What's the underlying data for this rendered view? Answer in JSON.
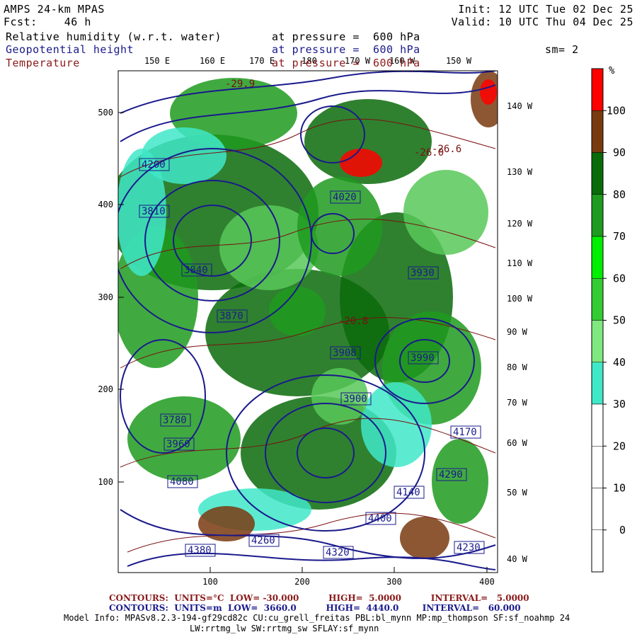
{
  "header": {
    "model": "AMPS 24-km MPAS",
    "fcst_label": "Fcst:",
    "fcst_value": "46 h",
    "init": "Init: 12 UTC Tue 02 Dec 25",
    "valid": "Valid: 10 UTC Thu 04 Dec 25",
    "fields": [
      {
        "name": "Relative humidity (w.r.t. water)",
        "level": "at pressure =  600 hPa",
        "color": "#000000"
      },
      {
        "name": "Geopotential height",
        "level": "at pressure =  600 hPa",
        "color": "#1a1a8c"
      },
      {
        "name": "Temperature",
        "level": "at pressure =  600 hPa",
        "color": "#8b1a1a"
      }
    ],
    "smoothing": "sm= 2"
  },
  "map": {
    "top_labels": [
      "150 E",
      "160 E",
      "170 E",
      "180",
      "170 W",
      "160 W",
      "150 W"
    ],
    "right_labels": [
      "140 W",
      "130 W",
      "120 W",
      "110 W",
      "100 W",
      "90 W",
      "80 W",
      "70 W",
      "60 W",
      "50 W",
      "40 W"
    ],
    "left_ticks": [
      "500",
      "400",
      "300",
      "200",
      "100"
    ],
    "bottom_ticks": [
      "100",
      "200",
      "300",
      "400"
    ],
    "height_labels": [
      "4380",
      "4260",
      "4200",
      "4080",
      "3960",
      "3840",
      "3870",
      "3900",
      "3908",
      "3990",
      "4020",
      "4140",
      "4320",
      "4290",
      "4230",
      "4400",
      "4170",
      "3930",
      "3810",
      "3780"
    ],
    "temp_labels": [
      "-29.9",
      "-20.8",
      "-26.0",
      "-26.6"
    ],
    "colors": {
      "height": "#1a1a8c",
      "temperature": "#7a1010",
      "rh_dark_green": "#0a6b0a",
      "rh_green": "#1f9b1f",
      "rh_light_green": "#58c858",
      "rh_cyan": "#3fe8c8",
      "rh_brown": "#7a3a10",
      "rh_red": "#ff0000"
    }
  },
  "colorbar": {
    "unit": "%",
    "labels": [
      "100",
      "90",
      "80",
      "70",
      "60",
      "50",
      "40",
      "30",
      "20",
      "10",
      "0"
    ],
    "segments": [
      "#ff0000",
      "#7a3a10",
      "#0a6b0a",
      "#1f9b1f",
      "#00ee00",
      "#33cc33",
      "#7fe87f",
      "#3fe8c8",
      "#ffffff",
      "#ffffff",
      "#ffffff",
      "#ffffff"
    ]
  },
  "footer": {
    "line1": "CONTOURS:  UNITS=°C  LOW= -30.000          HIGH=  5.0000          INTERVAL=   5.0000",
    "line2": "CONTOURS:  UNITS=m  LOW=  3660.0          HIGH=  4440.0        INTERVAL=   60.000",
    "line3": "Model Info: MPASv8.2.3-194-gf29cd82c CU:cu_grell_freitas PBL:bl_mynn MP:mp_thompson SF:sf_noahmp 24",
    "line4": "LW:rrtmg_lw SW:rrtmg_sw SFLAY:sf_mynn"
  }
}
